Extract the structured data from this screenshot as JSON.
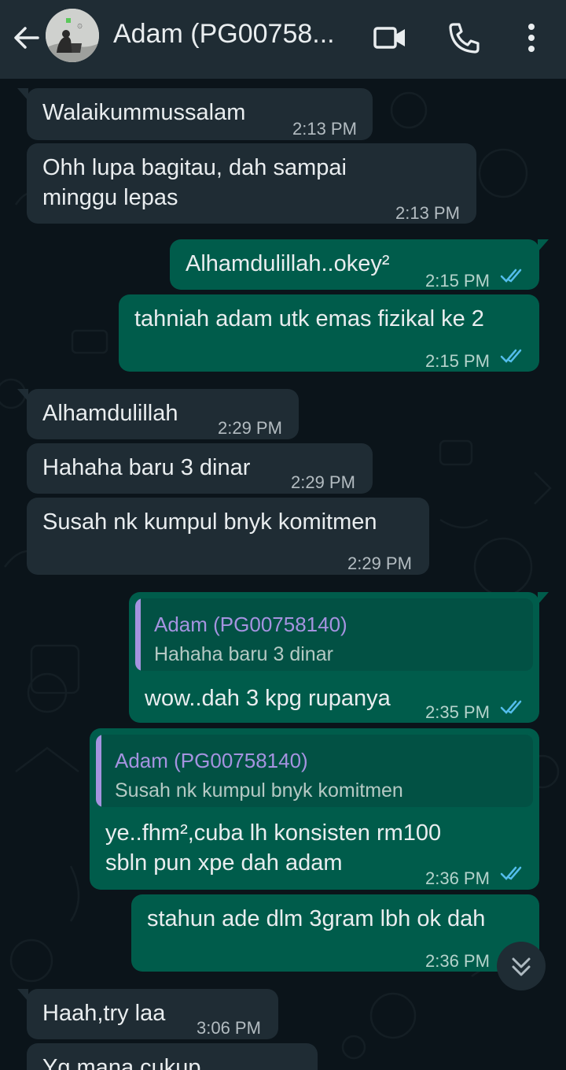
{
  "header": {
    "contact_name": "Adam (PG00758...",
    "icons": [
      "back-arrow-icon",
      "video-call-icon",
      "phone-icon",
      "more-vertical-icon"
    ]
  },
  "messages": [
    {
      "dir": "in",
      "text": "Walaikummussalam",
      "time": "2:13 PM"
    },
    {
      "dir": "in",
      "lines": [
        "Ohh lupa bagitau, dah sampai",
        "minggu lepas"
      ],
      "time": "2:13 PM"
    },
    {
      "dir": "out",
      "text": "Alhamdulillah..okey²",
      "time": "2:15 PM",
      "status": "read"
    },
    {
      "dir": "out",
      "text": "tahniah adam utk emas fizikal ke 2",
      "time": "2:15 PM",
      "status": "read"
    },
    {
      "dir": "in",
      "text": "Alhamdulillah",
      "time": "2:29 PM"
    },
    {
      "dir": "in",
      "text": "Hahaha baru 3 dinar",
      "time": "2:29 PM"
    },
    {
      "dir": "in",
      "text": "Susah nk kumpul bnyk komitmen",
      "time": "2:29 PM"
    },
    {
      "dir": "out",
      "quote_name": "Adam (PG00758140)",
      "quote_text": "Hahaha baru 3 dinar",
      "text": "wow..dah 3 kpg rupanya",
      "time": "2:35 PM",
      "status": "read"
    },
    {
      "dir": "out",
      "quote_name": "Adam (PG00758140)",
      "quote_text": "Susah nk kumpul bnyk komitmen",
      "lines": [
        "ye..fhm²,cuba lh konsisten rm100",
        "sbln pun xpe dah adam"
      ],
      "time": "2:36 PM",
      "status": "read"
    },
    {
      "dir": "out",
      "text": "stahun ade dlm 3gram lbh ok dah",
      "time": "2:36 PM",
      "status": "read"
    },
    {
      "dir": "in",
      "text": "Haah,try laa",
      "time": "3:06 PM"
    },
    {
      "dir": "in",
      "text": "Yg mana cukup",
      "time": ""
    }
  ],
  "colors": {
    "header_bg": "#1f2c34",
    "chat_bg": "#0b141a",
    "incoming_bubble": "#1f2c34",
    "outgoing_bubble": "#005c4b",
    "quote_name": "#a593e0",
    "read_ticks": "#53bdeb"
  }
}
